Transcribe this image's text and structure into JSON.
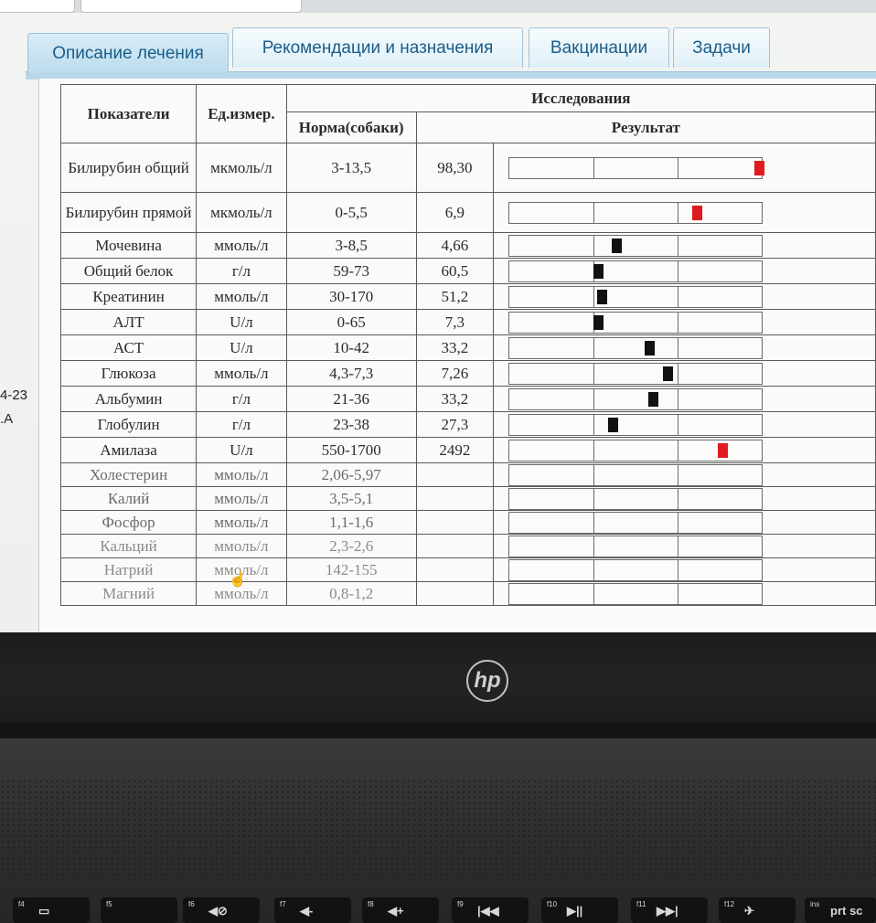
{
  "left_labels": [
    "4-23",
    ".A"
  ],
  "tabs": [
    {
      "label": "Описание лечения",
      "active": true
    },
    {
      "label": "Рекомендации и назначения",
      "active": false
    },
    {
      "label": "Вакцинации",
      "active": false
    },
    {
      "label": "Задачи",
      "active": false
    }
  ],
  "table": {
    "group_header": "Исследования",
    "headers": {
      "name": "Показатели",
      "unit": "Ед.измер.",
      "norm": "Норма(собаки)",
      "result": "Результат"
    },
    "rows": [
      {
        "name": "Билирубин общий",
        "unit": "мкмоль/л",
        "norm": "3-13,5",
        "value": "98,30",
        "marker": "red"
      },
      {
        "name": "Билирубин прямой",
        "unit": "мкмоль/л",
        "norm": "0-5,5",
        "value": "6,9",
        "marker": "red"
      },
      {
        "name": "Мочевина",
        "unit": "ммоль/л",
        "norm": "3-8,5",
        "value": "4,66",
        "marker": "black"
      },
      {
        "name": "Общий белок",
        "unit": "г/л",
        "norm": "59-73",
        "value": "60,5",
        "marker": "black"
      },
      {
        "name": "Креатинин",
        "unit": "ммоль/л",
        "norm": "30-170",
        "value": "51,2",
        "marker": "black"
      },
      {
        "name": "АЛТ",
        "unit": "U/л",
        "norm": "0-65",
        "value": "7,3",
        "marker": "black"
      },
      {
        "name": "АСТ",
        "unit": "U/л",
        "norm": "10-42",
        "value": "33,2",
        "marker": "black"
      },
      {
        "name": "Глюкоза",
        "unit": "ммоль/л",
        "norm": "4,3-7,3",
        "value": "7,26",
        "marker": "black"
      },
      {
        "name": "Альбумин",
        "unit": "г/л",
        "norm": "21-36",
        "value": "33,2",
        "marker": "black"
      },
      {
        "name": "Глобулин",
        "unit": "г/л",
        "norm": "23-38",
        "value": "27,3",
        "marker": "black"
      },
      {
        "name": "Амилаза",
        "unit": "U/л",
        "norm": "550-1700",
        "value": "2492",
        "marker": "red"
      },
      {
        "name": "Холестерин",
        "unit": "ммоль/л",
        "norm": "2,06-5,97",
        "value": "",
        "marker": ""
      },
      {
        "name": "Калий",
        "unit": "ммоль/л",
        "norm": "3,5-5,1",
        "value": "",
        "marker": ""
      },
      {
        "name": "Фосфор",
        "unit": "ммоль/л",
        "norm": "1,1-1,6",
        "value": "",
        "marker": ""
      },
      {
        "name": "Кальций",
        "unit": "ммоль/л",
        "norm": "2,3-2,6",
        "value": "",
        "marker": ""
      },
      {
        "name": "Натрий",
        "unit": "ммоль/л",
        "norm": "142-155",
        "value": "",
        "marker": ""
      },
      {
        "name": "Магний",
        "unit": "ммоль/л",
        "norm": "0,8-1,2",
        "value": "",
        "marker": ""
      }
    ]
  },
  "colors": {
    "marker_red": "#e01b1f",
    "marker_black": "#111111",
    "tab_text": "#1a5d8a"
  },
  "laptop": {
    "brand": "hp",
    "fkeys": [
      {
        "label": "f4",
        "symbol": "▭"
      },
      {
        "label": "f5",
        "symbol": ""
      },
      {
        "label": "f6",
        "symbol": "◀⊘"
      },
      {
        "label": "f7",
        "symbol": "◀-"
      },
      {
        "label": "f8",
        "symbol": "◀+"
      },
      {
        "label": "f9",
        "symbol": "|◀◀"
      },
      {
        "label": "f10",
        "symbol": "▶||"
      },
      {
        "label": "f11",
        "symbol": "▶▶|"
      },
      {
        "label": "f12",
        "symbol": "✈"
      },
      {
        "label": "ins",
        "symbol": "prt sc"
      }
    ]
  }
}
